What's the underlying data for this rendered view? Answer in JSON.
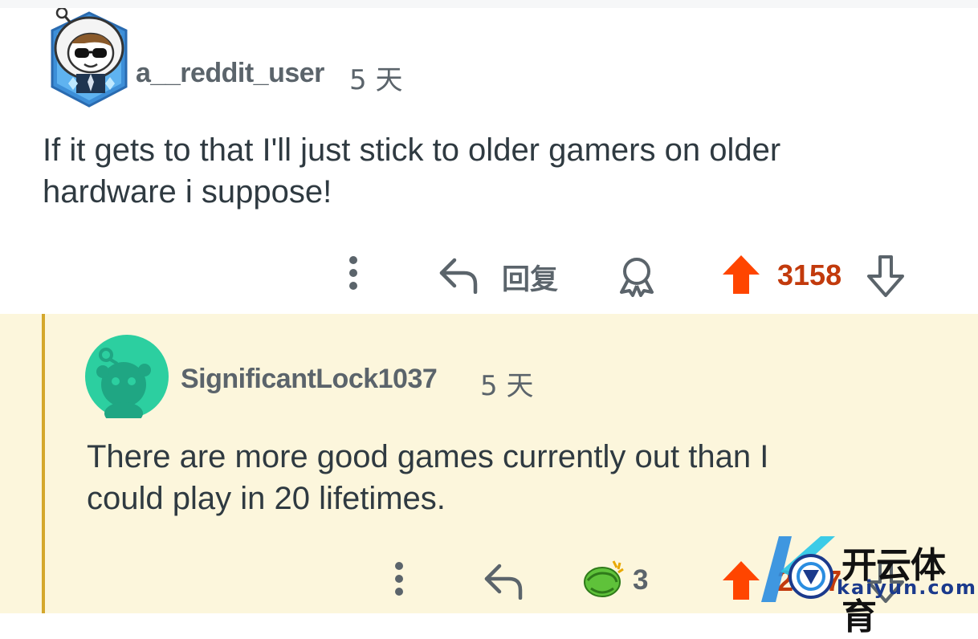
{
  "comment": {
    "username": "a__reddit_user",
    "timestamp": "5 天",
    "body": "If it gets to that I'll just stick to older gamers on older\nhardware i suppose!",
    "actions": {
      "reply_label": "回复",
      "vote_count": "3158"
    }
  },
  "reply": {
    "username": "SignificantLock1037",
    "timestamp": "5 天",
    "body": "There are more good games currently out than I\ncould play in 20 lifetimes.",
    "actions": {
      "award_count": "3",
      "vote_count": "2397"
    }
  },
  "watermark": {
    "chinese": "开云体育",
    "url": "kaiyun.com"
  },
  "colors": {
    "upvote": "#ff4500",
    "vote_count": "#c23a0c",
    "reply_background": "#fcf6dc",
    "thread_line": "#d4a72c",
    "avatar_green": "#2ccfa0"
  },
  "icons": [
    "more-options-icon",
    "reply-arrow-icon",
    "award-icon",
    "upvote-arrow-icon",
    "downvote-arrow-icon",
    "award-badge-icon"
  ]
}
